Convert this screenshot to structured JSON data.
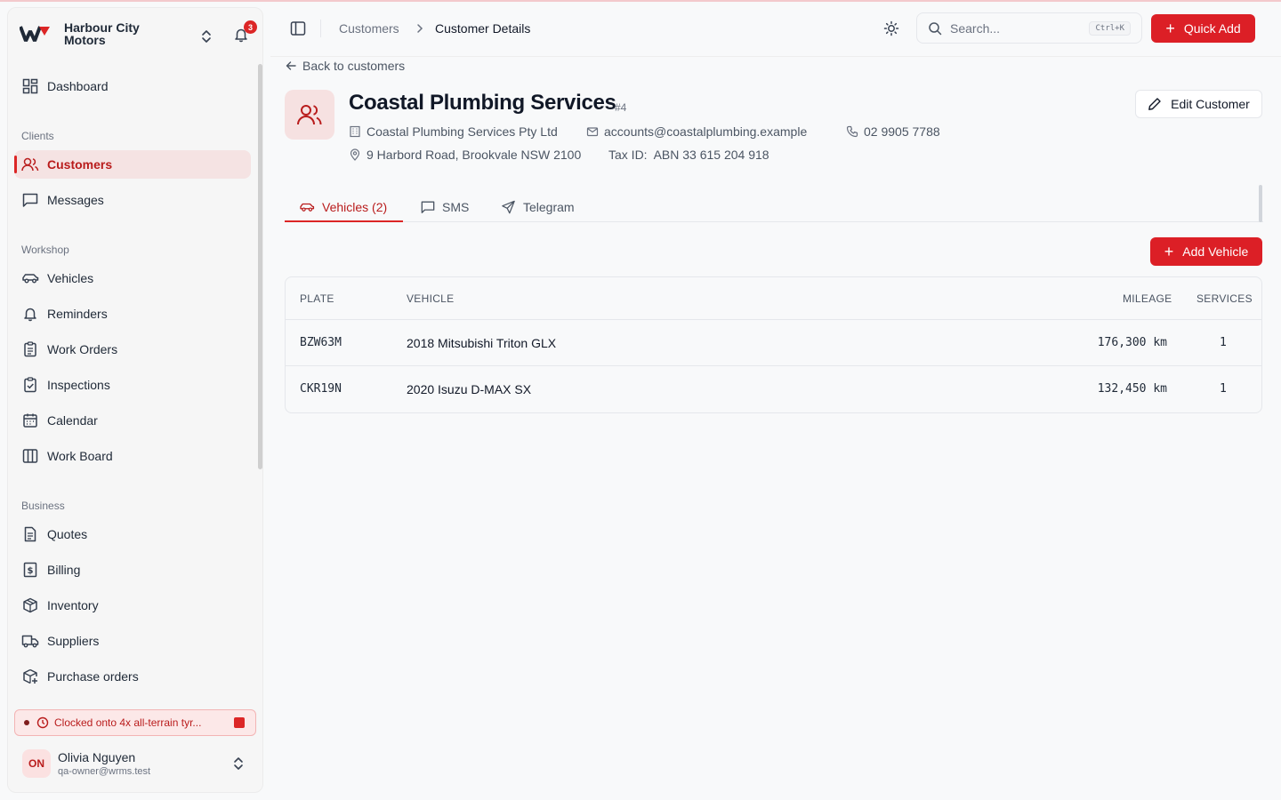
{
  "brand": {
    "name": "Harbour City Motors",
    "notifications": "3"
  },
  "nav": {
    "dashboard": "Dashboard",
    "sections": {
      "clients": "Clients",
      "workshop": "Workshop",
      "business": "Business"
    },
    "items": {
      "customers": "Customers",
      "messages": "Messages",
      "vehicles": "Vehicles",
      "reminders": "Reminders",
      "work_orders": "Work Orders",
      "inspections": "Inspections",
      "calendar": "Calendar",
      "work_board": "Work Board",
      "quotes": "Quotes",
      "billing": "Billing",
      "inventory": "Inventory",
      "suppliers": "Suppliers",
      "purchase_orders": "Purchase orders"
    }
  },
  "clock": {
    "text": "Clocked onto 4x all-terrain tyr..."
  },
  "user": {
    "initials": "ON",
    "name": "Olivia Nguyen",
    "email": "qa-owner@wrms.test"
  },
  "header": {
    "breadcrumb": [
      "Customers",
      "Customer Details"
    ],
    "search_placeholder": "Search...",
    "shortcut": "Ctrl+K",
    "quick_add": "Quick Add"
  },
  "customer": {
    "back": "Back to customers",
    "name": "Coastal Plumbing Services",
    "id": "#4",
    "company": "Coastal Plumbing Services Pty Ltd",
    "email": "accounts@coastalplumbing.example",
    "phone": "02 9905 7788",
    "address": "9 Harbord Road, Brookvale NSW 2100",
    "tax_label": "Tax ID:",
    "tax_id": "ABN 33 615 204 918",
    "edit": "Edit Customer"
  },
  "tabs": {
    "vehicles": "Vehicles (2)",
    "sms": "SMS",
    "telegram": "Telegram"
  },
  "add_vehicle": "Add Vehicle",
  "table": {
    "headers": {
      "plate": "PLATE",
      "vehicle": "VEHICLE",
      "mileage": "MILEAGE",
      "services": "SERVICES"
    },
    "rows": [
      {
        "plate": "BZW63M",
        "vehicle": "2018 Mitsubishi Triton GLX",
        "mileage": "176,300 km",
        "services": "1"
      },
      {
        "plate": "CKR19N",
        "vehicle": "2020 Isuzu D-MAX SX",
        "mileage": "132,450 km",
        "services": "1"
      }
    ]
  },
  "colors": {
    "accent": "#dc1f26",
    "accent_soft": "#f5e3e3"
  }
}
